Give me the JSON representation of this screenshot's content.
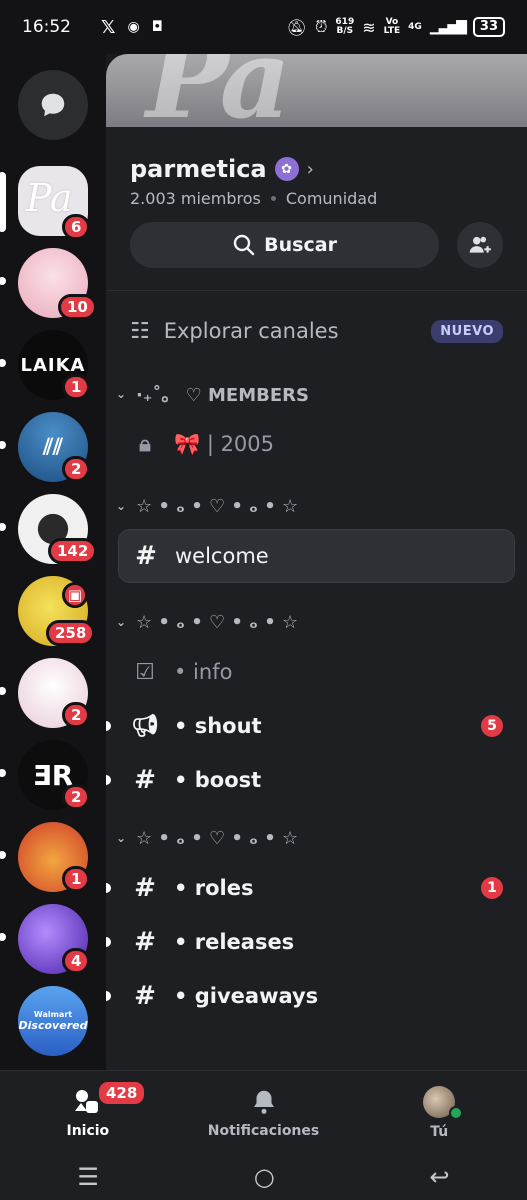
{
  "status_bar": {
    "time": "16:52",
    "speed_value": "619",
    "speed_unit": "B/S",
    "net_top": "Vo",
    "net_bottom": "LTE",
    "network": "4G",
    "battery": "33"
  },
  "rail": {
    "servers": [
      {
        "name": "parmetica",
        "badge": "6",
        "color": "#e8e6ea"
      },
      {
        "name": "anime-pink",
        "badge": "10",
        "color": "#f4c7d2"
      },
      {
        "name": "laika",
        "badge": "1",
        "color": "#0b0b0b",
        "label": "LAIKA"
      },
      {
        "name": "adidas",
        "badge": "2",
        "color": "#2e6fa8"
      },
      {
        "name": "anime-dark",
        "badge": "142",
        "color": "#f0f0f0"
      },
      {
        "name": "yellow",
        "badge": "258",
        "color": "#e8c93a"
      },
      {
        "name": "anime-pastel",
        "badge": "2",
        "color": "#f1e4ea"
      },
      {
        "name": "er-logo",
        "badge": "2",
        "color": "#0d0d0d"
      },
      {
        "name": "cute-creature",
        "badge": "1",
        "color": "#e8883d"
      },
      {
        "name": "purple-art",
        "badge": "4",
        "color": "#6c3bd1"
      },
      {
        "name": "walmart-discovered",
        "badge": "",
        "color": "#3a7fd4",
        "label_top": "Walmart",
        "label_bottom": "Discovered"
      }
    ]
  },
  "server": {
    "banner_text": "Pa",
    "name": "parmetica",
    "verified_icon": "✿",
    "members": "2.003 miembros",
    "type": "Comunidad",
    "search_label": "Buscar"
  },
  "explore": {
    "label": "Explorar canales",
    "tag": "NUEVO"
  },
  "categories": [
    {
      "label": "⋅₊˚。 ♡ MEMBERS"
    },
    {
      "label": "☆ • ₒ • ♡ • ₒ • ☆"
    },
    {
      "label": "☆ • ₒ • ♡ • ₒ • ☆"
    },
    {
      "label": "☆ • ₒ • ♡ • ₒ • ☆"
    }
  ],
  "channels": {
    "members_2005": "🎀 | 2005",
    "welcome": "welcome",
    "info": "• info",
    "shout": "• shout",
    "shout_badge": "5",
    "boost": "• boost",
    "roles": "• roles",
    "roles_badge": "1",
    "releases": "• releases",
    "giveaways": "• giveaways"
  },
  "tabbar": {
    "home": "Inicio",
    "home_badge": "428",
    "notifications": "Notificaciones",
    "you": "Tú"
  }
}
